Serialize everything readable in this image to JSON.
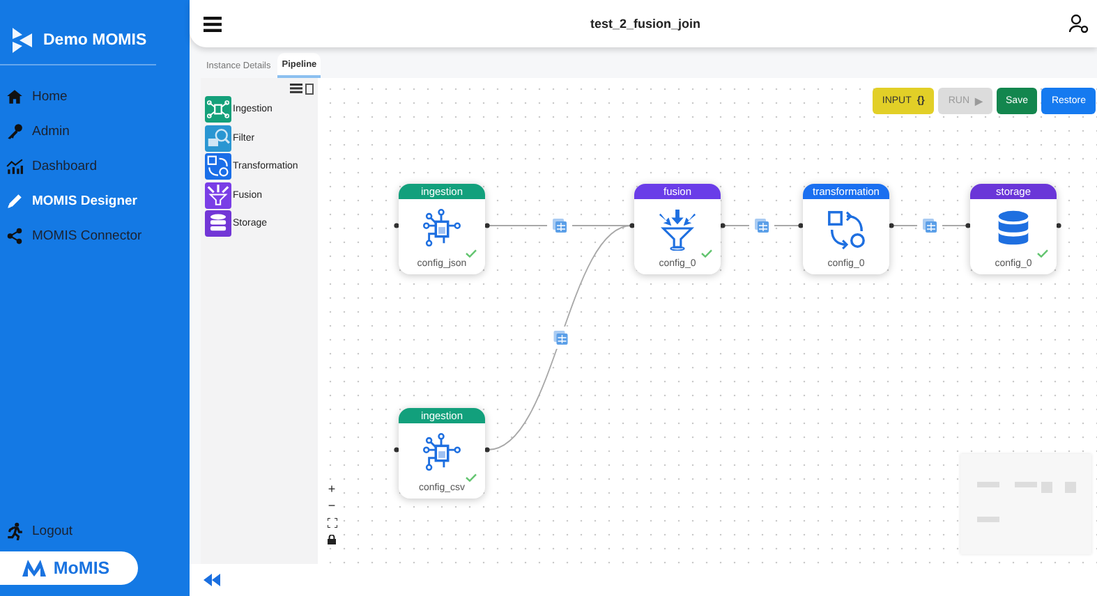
{
  "sidebar": {
    "brand": "Demo MOMIS",
    "items": [
      {
        "label": "Home",
        "kind": "home",
        "selected": false
      },
      {
        "label": "Admin",
        "kind": "admin",
        "selected": false
      },
      {
        "label": "Dashboard",
        "kind": "dashboard",
        "selected": false
      },
      {
        "label": "MOMIS Designer",
        "kind": "designer",
        "selected": true
      },
      {
        "label": "MOMIS Connector",
        "kind": "connector",
        "selected": false
      }
    ],
    "logout": "Logout",
    "logo": "MoMIS"
  },
  "header": {
    "title": "test_2_fusion_join"
  },
  "tabs": [
    {
      "label": "Instance Details",
      "selected": false
    },
    {
      "label": "Pipeline",
      "selected": true
    }
  ],
  "palette": [
    {
      "label": "Ingestion",
      "kind": "ingestion",
      "color": "#14a07a"
    },
    {
      "label": "Filter",
      "kind": "filter",
      "color": "#2a96d2"
    },
    {
      "label": "Transformation",
      "kind": "transformation",
      "color": "#1a6ee8"
    },
    {
      "label": "Fusion",
      "kind": "fusion",
      "color": "#7a3ee6"
    },
    {
      "label": "Storage",
      "kind": "storage",
      "color": "#7236d6"
    }
  ],
  "toolbar": [
    {
      "label": "INPUT",
      "symbol": "{}",
      "kind": "input",
      "disabled": false
    },
    {
      "label": "RUN",
      "symbol": "▶",
      "kind": "run",
      "disabled": true
    },
    {
      "label": "Save",
      "kind": "save",
      "disabled": false
    },
    {
      "label": "Restore",
      "kind": "restore",
      "disabled": false
    }
  ],
  "nodes": [
    {
      "type": "ingestion",
      "label": "config_json",
      "kind": "ingestion",
      "color": "#12a07c",
      "checked": true
    },
    {
      "type": "fusion",
      "label": "config_0",
      "kind": "fusion",
      "color": "#6a3de8",
      "checked": true
    },
    {
      "type": "transformation",
      "label": "config_0",
      "kind": "transformation",
      "color": "#1a6ff0",
      "checked": false
    },
    {
      "type": "storage",
      "label": "config_0",
      "kind": "storage",
      "color": "#6a36d8",
      "checked": true
    },
    {
      "type": "ingestion",
      "label": "config_csv",
      "kind": "ingestion",
      "color": "#12a07c",
      "checked": true
    }
  ],
  "zoom_controls": [
    "+",
    "−"
  ]
}
